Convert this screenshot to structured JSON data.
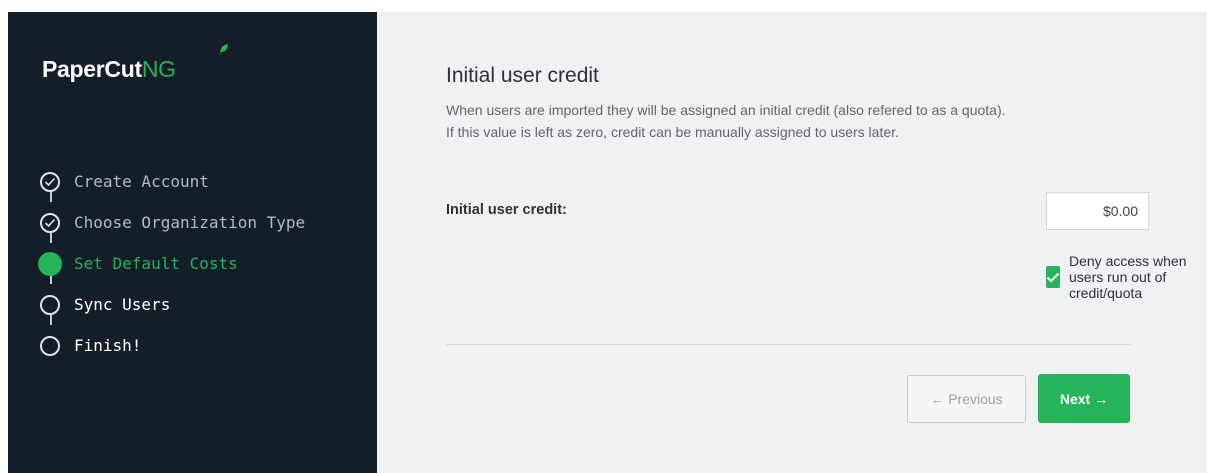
{
  "brand": {
    "name_primary": "PaperCut",
    "name_secondary": "NG",
    "accent_color": "#25b45a"
  },
  "steps": [
    {
      "label": "Create Account",
      "state": "completed"
    },
    {
      "label": "Choose Organization Type",
      "state": "completed"
    },
    {
      "label": "Set Default Costs",
      "state": "active"
    },
    {
      "label": "Sync Users",
      "state": "pending"
    },
    {
      "label": "Finish!",
      "state": "pending"
    }
  ],
  "content": {
    "title": "Initial user credit",
    "description_line1": "When users are imported they will be assigned an initial credit (also refered to as a quota).",
    "description_line2": "If this value is left as zero, credit can be manually assigned to users later.",
    "credit_label": "Initial user credit:",
    "credit_value": "$0.00",
    "deny_access_label": "Deny access when users run out of credit/quota",
    "deny_access_checked": true
  },
  "buttons": {
    "previous": "← Previous",
    "next": "Next →"
  }
}
